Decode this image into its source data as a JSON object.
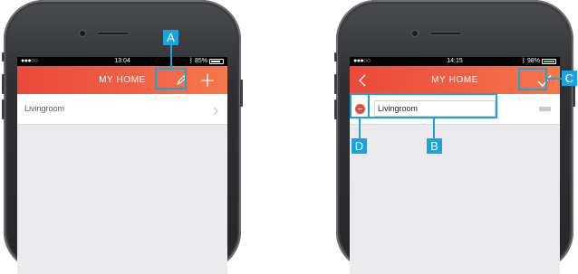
{
  "left_screen": {
    "status": {
      "signal": "●●●○○",
      "time": "13:04",
      "battery": "85%"
    },
    "nav": {
      "title": "MY HOME",
      "edit_icon": "pencil-icon",
      "add_icon": "plus-icon"
    },
    "rooms": [
      {
        "label": "Livingroom"
      }
    ]
  },
  "right_screen": {
    "status": {
      "signal": "●●●○○",
      "time": "14:15",
      "battery": "98%"
    },
    "nav": {
      "title": "MY HOME",
      "back_icon": "back-chevron-icon",
      "confirm_icon": "checkmark-icon"
    },
    "rooms": [
      {
        "value": "Livingroom"
      }
    ]
  },
  "callouts": {
    "a": "A",
    "b": "B",
    "c": "C",
    "d": "D"
  },
  "colors": {
    "nav_start": "#ea4a3b",
    "nav_end": "#f5784a",
    "callout": "#1aa3dd",
    "delete": "#e84a3b"
  }
}
